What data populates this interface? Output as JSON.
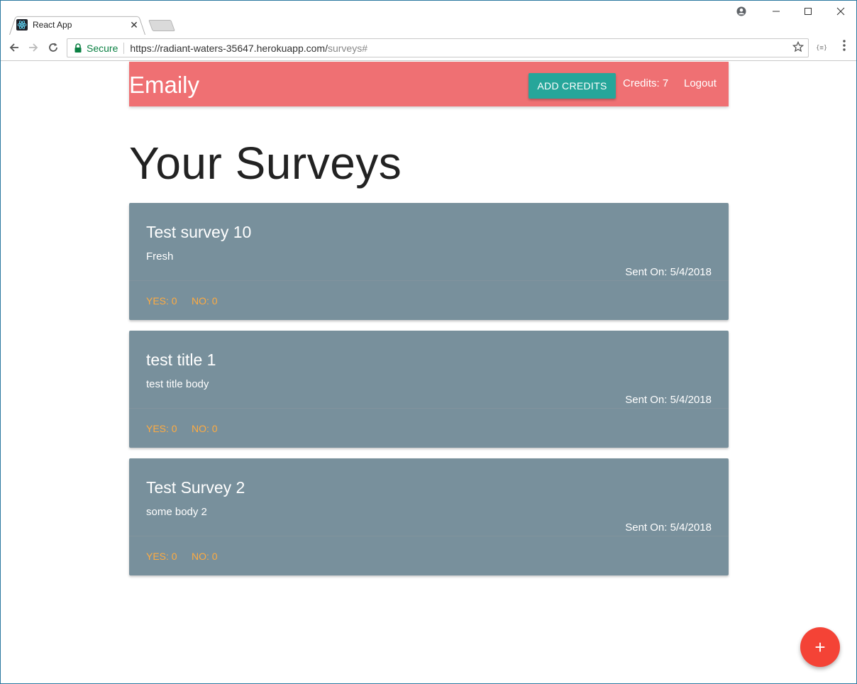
{
  "browser": {
    "tab_title": "React App",
    "tab_close": "✕",
    "url_secure_label": "Secure",
    "url_host": "https://radiant-waters-35647.herokuapp.com/",
    "url_path": "surveys#",
    "icons": {
      "favicon": "react-icon",
      "back": "back-arrow-icon",
      "forward": "forward-arrow-icon",
      "reload": "reload-icon",
      "lock": "lock-icon",
      "star": "bookmark-star-icon",
      "extension": "extension-icon",
      "menu": "menu-dots-icon",
      "profile": "profile-icon",
      "minimize": "minimize-icon",
      "maximize": "maximize-icon",
      "close": "close-icon"
    }
  },
  "nav": {
    "brand": "Emaily",
    "add_credits": "ADD CREDITS",
    "credits": "Credits: 7",
    "logout": "Logout",
    "color": "#ef7073",
    "button_color": "#26a69a"
  },
  "main": {
    "title": "Your Surveys",
    "surveys": [
      {
        "title": "Test survey 10",
        "body": "Fresh",
        "sent": "Sent On: 5/4/2018",
        "yes": "YES: 0",
        "no": "NO: 0"
      },
      {
        "title": "test title 1",
        "body": "test title body",
        "sent": "Sent On: 5/4/2018",
        "yes": "YES: 0",
        "no": "NO: 0"
      },
      {
        "title": "Test Survey 2",
        "body": "some body 2",
        "sent": "Sent On: 5/4/2018",
        "yes": "YES: 0",
        "no": "NO: 0"
      }
    ],
    "card_color": "#78909c",
    "action_color": "#ffab40"
  },
  "fab": {
    "label": "+",
    "color": "#f44336"
  }
}
